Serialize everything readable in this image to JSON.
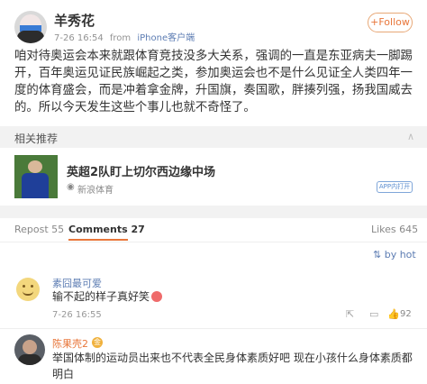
{
  "post": {
    "username": "羊秀花",
    "time": "7-26 16:54",
    "from_label": "from",
    "source": "iPhone客户端",
    "follow_label": "+Follow",
    "text": "咱对待奥运会本来就跟体育竞技没多大关系，强调的一直是东亚病夫一脚踢开，百年奥运见证民族崛起之类，参加奥运会也不是什么见证全人类四年一度的体育盛会，而是冲着拿金牌，升国旗，奏国歌，胖揍列强，扬我国威去的。所以今天发生这些个事儿也就不奇怪了。"
  },
  "related": {
    "title": "相关推荐",
    "headline": "英超2队盯上切尔西边缘中场",
    "source": "新浪体育",
    "badge": "APP内打开"
  },
  "tabs": {
    "repost": "Repost 55",
    "comments": "Comments 27",
    "likes": "Likes 645"
  },
  "sort": {
    "label": "by hot"
  },
  "comments": [
    {
      "name": "素囧最可爱",
      "text": "输不起的样子真好笑",
      "time": "7-26 16:55",
      "likes": "92"
    },
    {
      "name": "陈果壳2",
      "badge": "金",
      "text": "举国体制的运动员出来也不代表全民身体素质好吧 现在小孩什么身体素质都明白"
    }
  ],
  "icons": {
    "share": "share-icon",
    "comment": "comment-icon",
    "like": "like-icon",
    "collapse": "chevron-up-icon",
    "sort": "sort-icon",
    "news_source": "news-source-icon"
  },
  "colors": {
    "accent": "#e8763a",
    "link": "#5d7db3"
  }
}
